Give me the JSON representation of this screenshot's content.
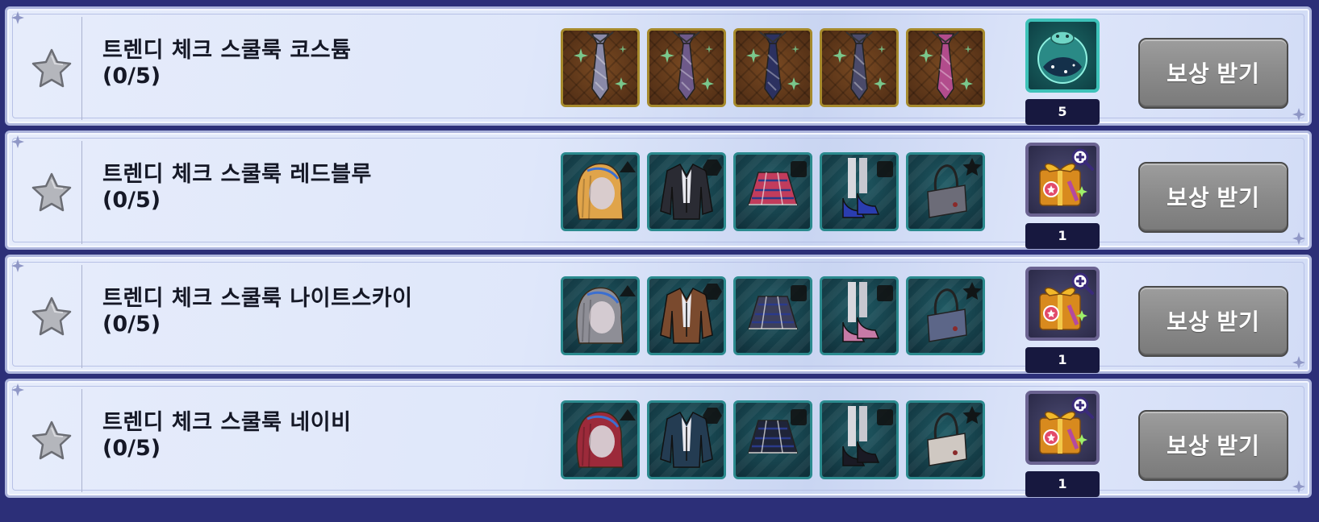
{
  "claim_label": "보상 받기",
  "rows": [
    {
      "title": "트렌디 체크 스쿨룩 코스튬",
      "progress": "(0/5)",
      "slot_style": "gold",
      "items": [
        {
          "icon": "tie-icon",
          "color": "#8a8aa8"
        },
        {
          "icon": "tie-icon",
          "color": "#6e5a8a"
        },
        {
          "icon": "tie-icon",
          "color": "#2c3160"
        },
        {
          "icon": "tie-icon",
          "color": "#4a4a6a"
        },
        {
          "icon": "tie-icon",
          "color": "#b24c8c"
        }
      ],
      "reward": {
        "icon": "bubble-orb-icon",
        "style": "teal-reward",
        "count": "5"
      }
    },
    {
      "title": "트렌디 체크 스쿨룩 레드블루",
      "progress": "(0/5)",
      "slot_style": "teal",
      "items": [
        {
          "icon": "hair-icon",
          "color": "#e0a44a"
        },
        {
          "icon": "jacket-icon",
          "color": "#2a2b33"
        },
        {
          "icon": "skirt-icon",
          "color": "#c23c5c"
        },
        {
          "icon": "shoes-icon",
          "color": "#2a3db0"
        },
        {
          "icon": "bag-icon",
          "color": "#6c6c78"
        }
      ],
      "reward": {
        "icon": "gift-box-icon",
        "style": "purple-reward",
        "count": "1"
      }
    },
    {
      "title": "트렌디 체크 스쿨룩 나이트스카이",
      "progress": "(0/5)",
      "slot_style": "teal",
      "items": [
        {
          "icon": "hair-icon",
          "color": "#8e8e96"
        },
        {
          "icon": "jacket-icon",
          "color": "#7a4a2e"
        },
        {
          "icon": "skirt-icon",
          "color": "#3c3f5c"
        },
        {
          "icon": "shoes-icon",
          "color": "#c77aa6"
        },
        {
          "icon": "bag-icon",
          "color": "#5c6688"
        }
      ],
      "reward": {
        "icon": "gift-box-icon",
        "style": "purple-reward",
        "count": "1"
      }
    },
    {
      "title": "트렌디 체크 스쿨룩 네이비",
      "progress": "(0/5)",
      "slot_style": "teal",
      "items": [
        {
          "icon": "hair-icon",
          "color": "#9c2a3a"
        },
        {
          "icon": "jacket-icon",
          "color": "#243c52"
        },
        {
          "icon": "skirt-icon",
          "color": "#1f2438"
        },
        {
          "icon": "shoes-icon",
          "color": "#1a1a24"
        },
        {
          "icon": "bag-icon",
          "color": "#cfc8c2"
        }
      ],
      "reward": {
        "icon": "gift-box-icon",
        "style": "purple-reward",
        "count": "1"
      }
    }
  ]
}
